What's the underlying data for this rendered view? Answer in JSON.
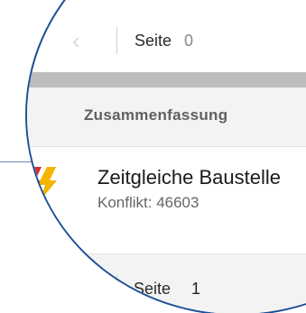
{
  "pager_top": {
    "label": "Seite",
    "page_number": "0"
  },
  "summary": {
    "title": "Zusammenfassung"
  },
  "conflict_card": {
    "title": "Zeitgleiche Baustelle",
    "subtitle": "Konflikt: 46603",
    "icon": "double-lightning-bolt-icon",
    "icon_colors": [
      "#d32f2f",
      "#f5b400"
    ]
  },
  "pager_bottom": {
    "label": "Seite",
    "page_number": "1"
  },
  "colors": {
    "lens_border": "#1c4f95",
    "section_background": "#f3f3f3",
    "separator_bar": "#bdbdbd"
  }
}
